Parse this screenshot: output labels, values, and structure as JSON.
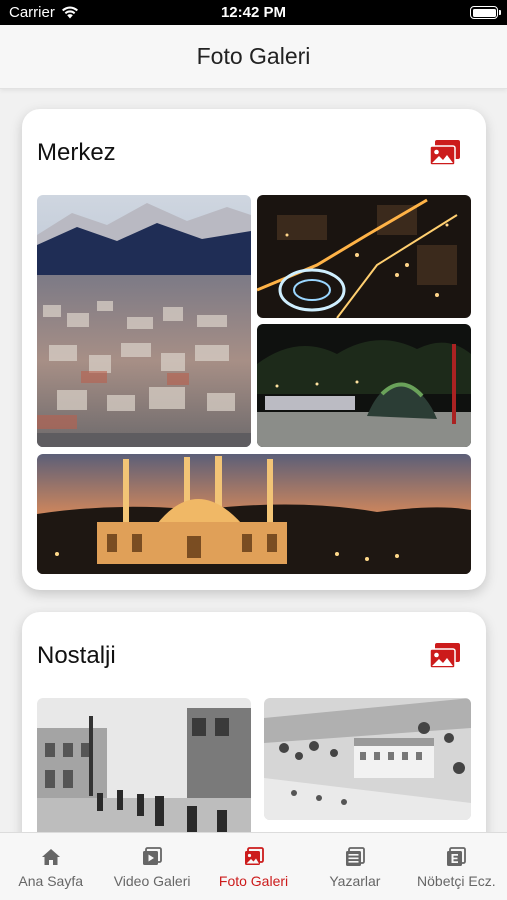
{
  "status_bar": {
    "carrier": "Carrier",
    "time": "12:42 PM"
  },
  "header": {
    "title": "Foto Galeri"
  },
  "galleries": [
    {
      "title": "Merkez",
      "icon": "photo-gallery-icon"
    },
    {
      "title": "Nostalji",
      "icon": "photo-gallery-icon"
    }
  ],
  "tab_bar": {
    "active_color": "#cc1b1b",
    "inactive_color": "#666666",
    "tabs": [
      {
        "label": "Ana Sayfa",
        "icon": "home-icon",
        "active": false
      },
      {
        "label": "Video Galeri",
        "icon": "video-icon",
        "active": false
      },
      {
        "label": "Foto Galeri",
        "icon": "photo-icon",
        "active": true
      },
      {
        "label": "Yazarlar",
        "icon": "newspaper-icon",
        "active": false
      },
      {
        "label": "Nöbetçi Ecz.",
        "icon": "pharmacy-icon",
        "active": false
      }
    ]
  }
}
